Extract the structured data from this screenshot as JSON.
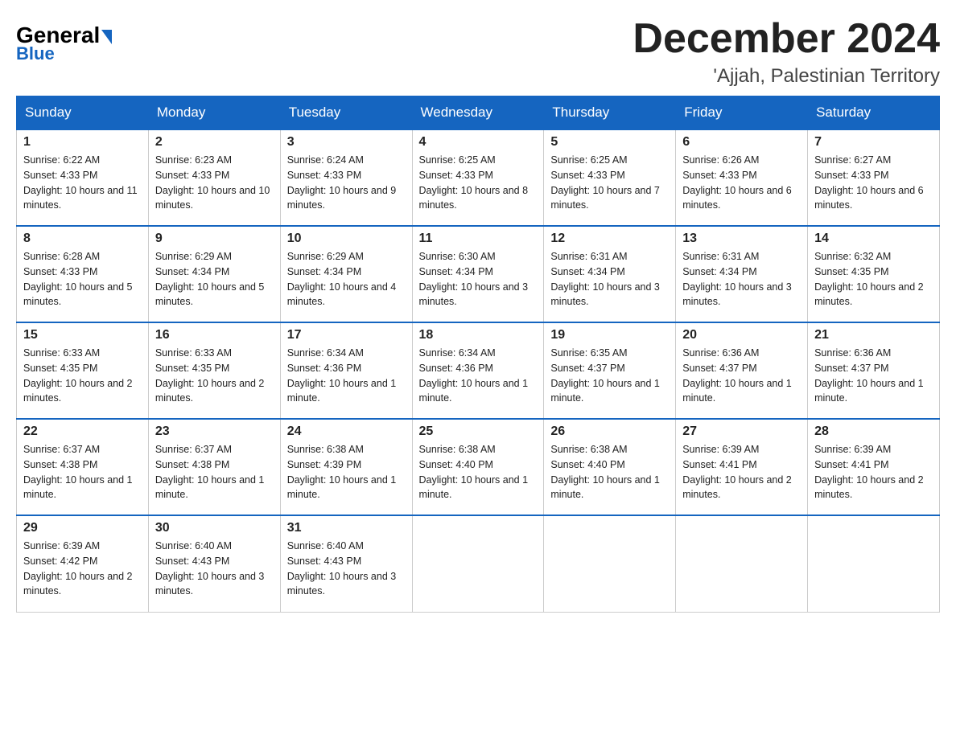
{
  "header": {
    "logo_general": "General",
    "logo_blue": "Blue",
    "month_title": "December 2024",
    "location": "'Ajjah, Palestinian Territory"
  },
  "days_of_week": [
    "Sunday",
    "Monday",
    "Tuesday",
    "Wednesday",
    "Thursday",
    "Friday",
    "Saturday"
  ],
  "weeks": [
    [
      {
        "day": "1",
        "sunrise": "6:22 AM",
        "sunset": "4:33 PM",
        "daylight": "10 hours and 11 minutes."
      },
      {
        "day": "2",
        "sunrise": "6:23 AM",
        "sunset": "4:33 PM",
        "daylight": "10 hours and 10 minutes."
      },
      {
        "day": "3",
        "sunrise": "6:24 AM",
        "sunset": "4:33 PM",
        "daylight": "10 hours and 9 minutes."
      },
      {
        "day": "4",
        "sunrise": "6:25 AM",
        "sunset": "4:33 PM",
        "daylight": "10 hours and 8 minutes."
      },
      {
        "day": "5",
        "sunrise": "6:25 AM",
        "sunset": "4:33 PM",
        "daylight": "10 hours and 7 minutes."
      },
      {
        "day": "6",
        "sunrise": "6:26 AM",
        "sunset": "4:33 PM",
        "daylight": "10 hours and 6 minutes."
      },
      {
        "day": "7",
        "sunrise": "6:27 AM",
        "sunset": "4:33 PM",
        "daylight": "10 hours and 6 minutes."
      }
    ],
    [
      {
        "day": "8",
        "sunrise": "6:28 AM",
        "sunset": "4:33 PM",
        "daylight": "10 hours and 5 minutes."
      },
      {
        "day": "9",
        "sunrise": "6:29 AM",
        "sunset": "4:34 PM",
        "daylight": "10 hours and 5 minutes."
      },
      {
        "day": "10",
        "sunrise": "6:29 AM",
        "sunset": "4:34 PM",
        "daylight": "10 hours and 4 minutes."
      },
      {
        "day": "11",
        "sunrise": "6:30 AM",
        "sunset": "4:34 PM",
        "daylight": "10 hours and 3 minutes."
      },
      {
        "day": "12",
        "sunrise": "6:31 AM",
        "sunset": "4:34 PM",
        "daylight": "10 hours and 3 minutes."
      },
      {
        "day": "13",
        "sunrise": "6:31 AM",
        "sunset": "4:34 PM",
        "daylight": "10 hours and 3 minutes."
      },
      {
        "day": "14",
        "sunrise": "6:32 AM",
        "sunset": "4:35 PM",
        "daylight": "10 hours and 2 minutes."
      }
    ],
    [
      {
        "day": "15",
        "sunrise": "6:33 AM",
        "sunset": "4:35 PM",
        "daylight": "10 hours and 2 minutes."
      },
      {
        "day": "16",
        "sunrise": "6:33 AM",
        "sunset": "4:35 PM",
        "daylight": "10 hours and 2 minutes."
      },
      {
        "day": "17",
        "sunrise": "6:34 AM",
        "sunset": "4:36 PM",
        "daylight": "10 hours and 1 minute."
      },
      {
        "day": "18",
        "sunrise": "6:34 AM",
        "sunset": "4:36 PM",
        "daylight": "10 hours and 1 minute."
      },
      {
        "day": "19",
        "sunrise": "6:35 AM",
        "sunset": "4:37 PM",
        "daylight": "10 hours and 1 minute."
      },
      {
        "day": "20",
        "sunrise": "6:36 AM",
        "sunset": "4:37 PM",
        "daylight": "10 hours and 1 minute."
      },
      {
        "day": "21",
        "sunrise": "6:36 AM",
        "sunset": "4:37 PM",
        "daylight": "10 hours and 1 minute."
      }
    ],
    [
      {
        "day": "22",
        "sunrise": "6:37 AM",
        "sunset": "4:38 PM",
        "daylight": "10 hours and 1 minute."
      },
      {
        "day": "23",
        "sunrise": "6:37 AM",
        "sunset": "4:38 PM",
        "daylight": "10 hours and 1 minute."
      },
      {
        "day": "24",
        "sunrise": "6:38 AM",
        "sunset": "4:39 PM",
        "daylight": "10 hours and 1 minute."
      },
      {
        "day": "25",
        "sunrise": "6:38 AM",
        "sunset": "4:40 PM",
        "daylight": "10 hours and 1 minute."
      },
      {
        "day": "26",
        "sunrise": "6:38 AM",
        "sunset": "4:40 PM",
        "daylight": "10 hours and 1 minute."
      },
      {
        "day": "27",
        "sunrise": "6:39 AM",
        "sunset": "4:41 PM",
        "daylight": "10 hours and 2 minutes."
      },
      {
        "day": "28",
        "sunrise": "6:39 AM",
        "sunset": "4:41 PM",
        "daylight": "10 hours and 2 minutes."
      }
    ],
    [
      {
        "day": "29",
        "sunrise": "6:39 AM",
        "sunset": "4:42 PM",
        "daylight": "10 hours and 2 minutes."
      },
      {
        "day": "30",
        "sunrise": "6:40 AM",
        "sunset": "4:43 PM",
        "daylight": "10 hours and 3 minutes."
      },
      {
        "day": "31",
        "sunrise": "6:40 AM",
        "sunset": "4:43 PM",
        "daylight": "10 hours and 3 minutes."
      },
      null,
      null,
      null,
      null
    ]
  ]
}
